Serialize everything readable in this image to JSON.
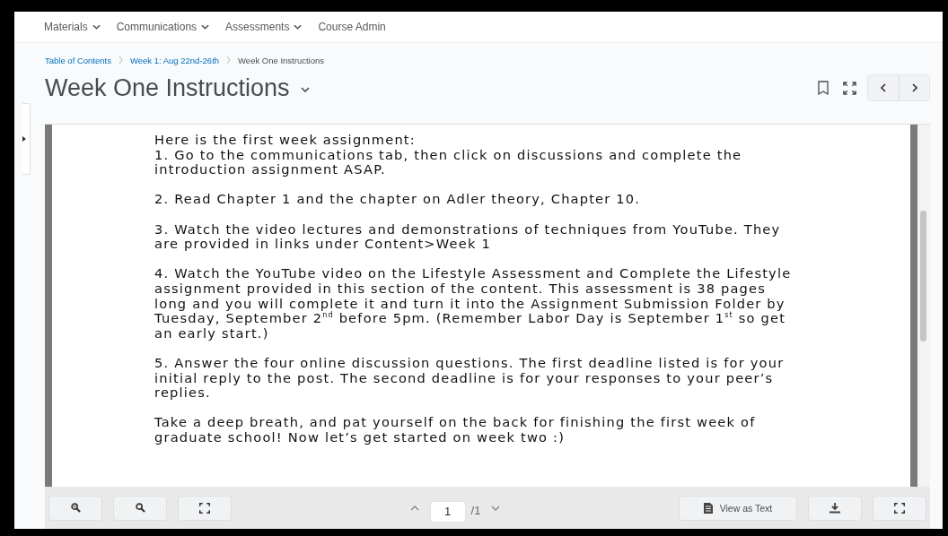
{
  "nav": [
    {
      "label": "Materials",
      "has_menu": true
    },
    {
      "label": "Communications",
      "has_menu": true
    },
    {
      "label": "Assessments",
      "has_menu": true
    },
    {
      "label": "Course Admin",
      "has_menu": false
    }
  ],
  "breadcrumbs": [
    {
      "label": "Table of Contents",
      "link": true
    },
    {
      "label": "Week 1: Aug 22nd-26th",
      "link": true
    },
    {
      "label": "Week One Instructions",
      "link": false
    }
  ],
  "title": "Week One Instructions",
  "document": {
    "paragraphs": [
      [
        "Here is the first week assignment:",
        "1.  Go to the communications tab, then click on discussions and complete the",
        "introduction assignment ASAP."
      ],
      [
        "2. Read Chapter 1 and the chapter on Adler theory, Chapter 10."
      ],
      [
        "3. Watch the video lectures and demonstrations of techniques from YouTube. They",
        "are provided in links under Content>Week 1"
      ],
      [
        "4. Watch the YouTube video on the Lifestyle Assessment and Complete the Lifestyle",
        "assignment provided in this section of the content. This assessment is 38 pages",
        "long and you will complete it and turn it into the Assignment Submission Folder by",
        "Tuesday, September 2$^{nd}$ before 5pm. (Remember Labor Day is September 1$^{st}$ so get",
        "an early start.)"
      ],
      [
        "5. Answer the four online discussion questions. The first deadline listed is for your",
        "initial reply to the post. The second deadline is for your responses to your peer’s",
        "replies."
      ],
      [
        "Take a deep breath, and pat yourself on the back for finishing the first week of",
        "graduate school! Now let’s get started on week two :)"
      ]
    ]
  },
  "toolbar": {
    "page": "1",
    "page_total": "/1",
    "view_as_text": "View as Text"
  }
}
